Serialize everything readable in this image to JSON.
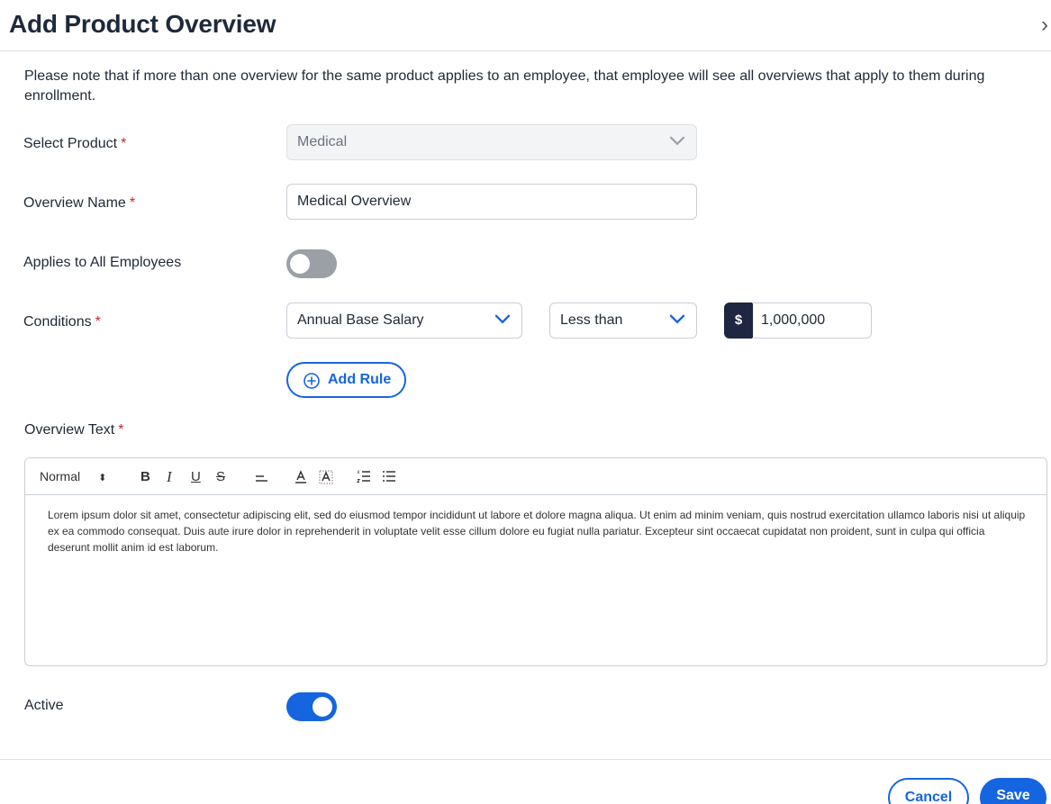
{
  "dialog": {
    "title": "Add Product Overview",
    "close_icon": "chevron-right-icon",
    "note": "Please note that if more than one overview for the same product applies to an employee, that employee will see all overviews that apply to them during enrollment."
  },
  "form": {
    "required_mark": "*",
    "select_product": {
      "label": "Select Product",
      "value": "Medical"
    },
    "overview_name": {
      "label": "Overview Name",
      "value": "Medical Overview"
    },
    "applies_all": {
      "label": "Applies to All Employees",
      "on": false
    },
    "conditions": {
      "label": "Conditions",
      "field": "Annual Base Salary",
      "operator": "Less than",
      "currency_symbol": "$",
      "amount": "1,000,000"
    },
    "add_rule_label": "Add Rule",
    "overview_text": {
      "label": "Overview Text",
      "toolbar": {
        "format": "Normal",
        "bold": "B",
        "italic": "I",
        "underline": "U",
        "strike": "S"
      },
      "content": "Lorem ipsum dolor sit amet, consectetur adipiscing elit, sed do eiusmod tempor incididunt ut labore et dolore magna aliqua. Ut enim ad minim veniam, quis nostrud exercitation ullamco laboris nisi ut aliquip ex ea commodo consequat. Duis aute irure dolor in reprehenderit in voluptate velit esse cillum dolore eu fugiat nulla pariatur. Excepteur sint occaecat cupidatat non proident, sunt in culpa qui officia deserunt mollit anim id est laborum."
    },
    "active": {
      "label": "Active",
      "on": true
    }
  },
  "footer": {
    "cancel_label": "Cancel",
    "save_label": "Save"
  },
  "colors": {
    "primary": "#1565e0",
    "dark": "#1e2642",
    "required": "#c62828",
    "toggle_off": "#9aa0a6"
  }
}
